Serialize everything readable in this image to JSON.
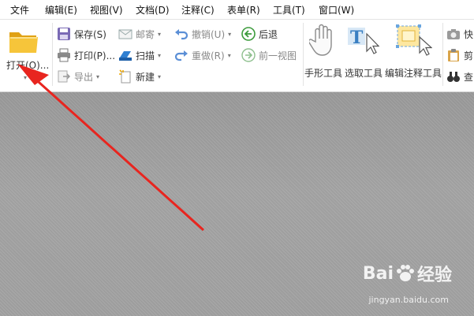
{
  "menubar": {
    "items": [
      "文件",
      "编辑(E)",
      "视图(V)",
      "文档(D)",
      "注释(C)",
      "表单(R)",
      "工具(T)",
      "窗口(W)"
    ]
  },
  "ribbon": {
    "open_label": "打开(O)...",
    "save_label": "保存(S)",
    "print_label": "打印(P)...",
    "export_label": "导出",
    "email_label": "邮寄",
    "scan_label": "扫描",
    "new_label": "新建",
    "undo_label": "撤销(U)",
    "redo_label": "重做(R)",
    "back_label": "后退",
    "forward_label": "前一视图",
    "hand_tool_label": "手形工具",
    "select_tool_label": "选取工具",
    "edit_annot_label": "编辑注释工具",
    "cut_label_1": "快",
    "cut_label_2": "剪",
    "cut_label_3": "查"
  },
  "watermark": {
    "brand_prefix": "Bai",
    "brand_suffix": "经验",
    "url": "jingyan.baidu.com"
  },
  "colors": {
    "annotation_arrow": "#e8251f",
    "folder": "#f3b928",
    "canvas": "#a3a3a3"
  }
}
